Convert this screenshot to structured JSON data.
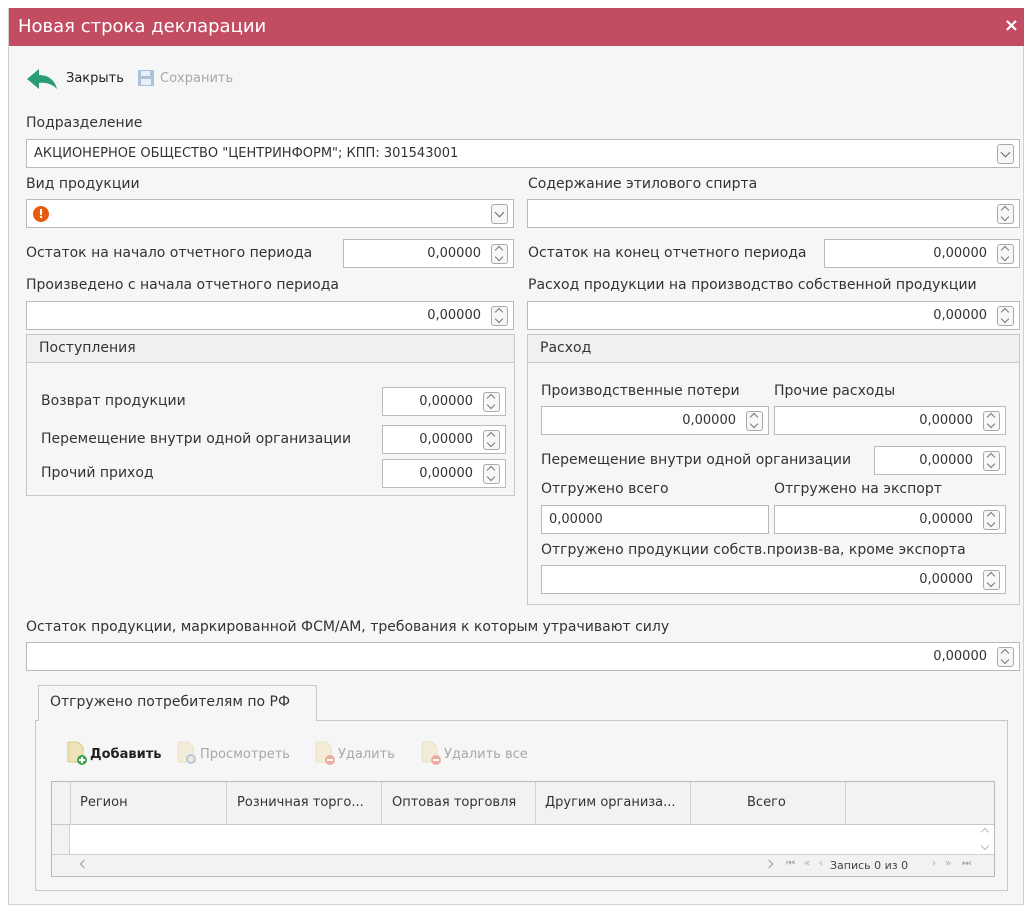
{
  "window": {
    "title": "Новая строка декларации",
    "close_glyph": "×"
  },
  "toolbar": {
    "close_label": "Закрыть",
    "save_label": "Сохранить"
  },
  "form": {
    "subdivision_label": "Подразделение",
    "subdivision_value": "АКЦИОНЕРНОЕ ОБЩЕСТВО \"ЦЕНТРИНФОРМ\"; КПП: 301543001",
    "product_type_label": "Вид продукции",
    "product_type_value": "",
    "ethyl_label": "Содержание этилового спирта",
    "ethyl_value": "",
    "start_balance_label": "Остаток на начало отчетного периода",
    "start_balance_value": "0,00000",
    "end_balance_label": "Остаток на конец отчетного периода",
    "end_balance_value": "0,00000",
    "produced_label": "Произведено с начала отчетного периода",
    "produced_value": "0,00000",
    "consumption_label": "Расход продукции на производство собственной продукции",
    "consumption_value": "0,00000"
  },
  "receipts": {
    "title": "Поступления",
    "return_label": "Возврат продукции",
    "return_value": "0,00000",
    "internal_label": "Перемещение внутри одной организации",
    "internal_value": "0,00000",
    "other_label": "Прочий приход",
    "other_value": "0,00000"
  },
  "expense": {
    "title": "Расход",
    "losses_label": "Производственные потери",
    "losses_value": "0,00000",
    "other_label": "Прочие расходы",
    "other_value": "0,00000",
    "internal_label": "Перемещение внутри одной организации",
    "internal_value": "0,00000",
    "shipped_total_label": "Отгружено всего",
    "shipped_total_value": "0,00000",
    "export_label": "Отгружено на экспорт",
    "export_value": "0,00000",
    "own_label": "Отгружено продукции собств.произв-ва, кроме экспорта",
    "own_value": "0,00000"
  },
  "fsm": {
    "label": "Остаток продукции, маркированной ФСМ/АМ, требования к которым утрачивают силу",
    "value": "0,00000"
  },
  "consumers_tab": {
    "label": "Отгружено потребителям по РФ",
    "buttons": {
      "add": "Добавить",
      "view": "Просмотреть",
      "delete": "Удалить",
      "delete_all": "Удалить все"
    },
    "columns": [
      "Регион",
      "Розничная торго...",
      "Оптовая торговля",
      "Другим организа...",
      "Всего"
    ],
    "pager": {
      "status": "Запись 0 из 0"
    }
  },
  "colors": {
    "titlebar": "#c24d62",
    "accent_green": "#2a9d78",
    "error": "#e8590c"
  }
}
